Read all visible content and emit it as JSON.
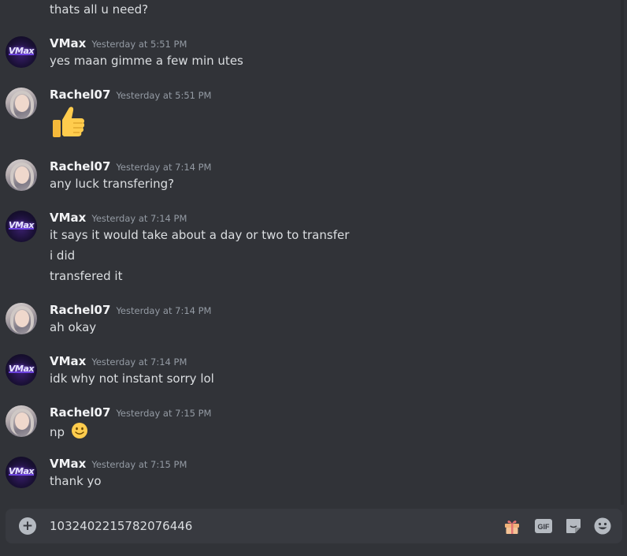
{
  "messages": [
    {
      "lines": [
        "thats all u need?"
      ]
    },
    {
      "user": "VMax",
      "timestamp": "Yesterday at 5:51 PM",
      "lines": [
        "yes maan gimme a few min utes"
      ]
    },
    {
      "user": "Rachel07",
      "timestamp": "Yesterday at 5:51 PM",
      "emoji": "thumbs-up"
    },
    {
      "user": "Rachel07",
      "timestamp": "Yesterday at 7:14 PM",
      "lines": [
        "any luck transfering?"
      ]
    },
    {
      "user": "VMax",
      "timestamp": "Yesterday at 7:14 PM",
      "lines": [
        "it says it would take about a day or two to transfer",
        "i did",
        "transfered it"
      ]
    },
    {
      "user": "Rachel07",
      "timestamp": "Yesterday at 7:14 PM",
      "lines": [
        "ah okay"
      ]
    },
    {
      "user": "VMax",
      "timestamp": "Yesterday at 7:14 PM",
      "lines": [
        "idk why not instant sorry lol"
      ]
    },
    {
      "user": "Rachel07",
      "timestamp": "Yesterday at 7:15 PM",
      "lines": [
        "np"
      ],
      "emoji": "slight-smile"
    },
    {
      "user": "VMax",
      "timestamp": "Yesterday at 7:15 PM",
      "lines": [
        "thank yo"
      ]
    }
  ],
  "avatars": {
    "vmax_logo": "VMax"
  },
  "composer": {
    "value": "1032402215782076446",
    "gif_label": "GIF",
    "icons": [
      "add-attachment-icon",
      "gift-icon",
      "gif-icon",
      "sticker-icon",
      "emoji-icon"
    ]
  },
  "colors": {
    "background": "#313338",
    "input_bg": "#383a40",
    "text": "#dbdee1",
    "username": "#f2f3f5",
    "timestamp": "#949ba4"
  }
}
